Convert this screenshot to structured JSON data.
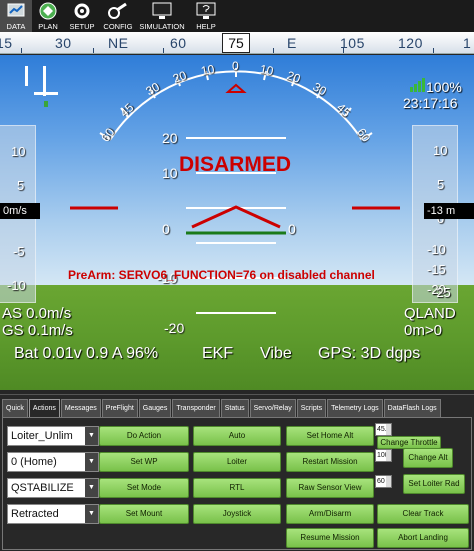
{
  "toolbar": {
    "items": [
      {
        "label": "DATA",
        "icon": "data-icon",
        "active": true
      },
      {
        "label": "PLAN",
        "icon": "plan-icon"
      },
      {
        "label": "SETUP",
        "icon": "setup-icon"
      },
      {
        "label": "CONFIG",
        "icon": "config-icon"
      },
      {
        "label": "SIMULATION",
        "icon": "simulation-icon"
      },
      {
        "label": "HELP",
        "icon": "help-icon"
      }
    ]
  },
  "compass": {
    "labels": [
      "15",
      "30",
      "NE",
      "60",
      "75",
      "E",
      "105",
      "120",
      "1"
    ],
    "heading": "75"
  },
  "hud": {
    "pitch_labels": [
      "20",
      "10",
      "0",
      "-10",
      "-20"
    ],
    "roll_labels": [
      "60",
      "45",
      "30",
      "20",
      "10",
      "0",
      "10",
      "20",
      "30",
      "45",
      "60"
    ],
    "status": "DISARMED",
    "prearm": "PreArm: SERVO6_FUNCTION=76 on disabled channel",
    "battery_pct": "100%",
    "time": "23:17:16",
    "airspeed": "AS 0.0m/s",
    "groundspeed": "GS 0.1m/s",
    "mode": "QLAND",
    "distance": "0m>0",
    "battery": "Bat 0.01v 0.9 A 96%",
    "ekf": "EKF",
    "vibe": "Vibe",
    "gps": "GPS: 3D dgps",
    "speed_tape": [
      "10",
      "5",
      "0",
      "-5",
      "-10"
    ],
    "speed_readout": "0m/s",
    "alt_tape": [
      "10",
      "5",
      "0",
      "-5",
      "-10",
      "-15",
      "-20",
      "-25"
    ],
    "alt_readout": "-13 m"
  },
  "panel": {
    "tabs": [
      "Quick",
      "Actions",
      "Messages",
      "PreFlight",
      "Gauges",
      "Transponder",
      "Status",
      "Servo/Relay",
      "Scripts",
      "Telemetry Logs",
      "DataFlash Logs"
    ],
    "active_tab": "Actions",
    "selects": [
      "Loiter_Unlim",
      "0 (Home)",
      "QSTABILIZE",
      "Retracted"
    ],
    "col1": [
      "Do Action",
      "Set WP",
      "Set Mode",
      "Set Mount"
    ],
    "col2": [
      "Auto",
      "Loiter",
      "RTL",
      "Joystick"
    ],
    "col3": [
      "Set Home Alt",
      "Restart Mission",
      "Raw Sensor View",
      "Arm/Disarm",
      "Resume Mission"
    ],
    "numbers": [
      "45.0",
      "100",
      "60"
    ],
    "col4": [
      "Change Throttle",
      "Change Alt",
      "Set Loiter Rad",
      "Clear Track",
      "Abort Landing"
    ]
  }
}
